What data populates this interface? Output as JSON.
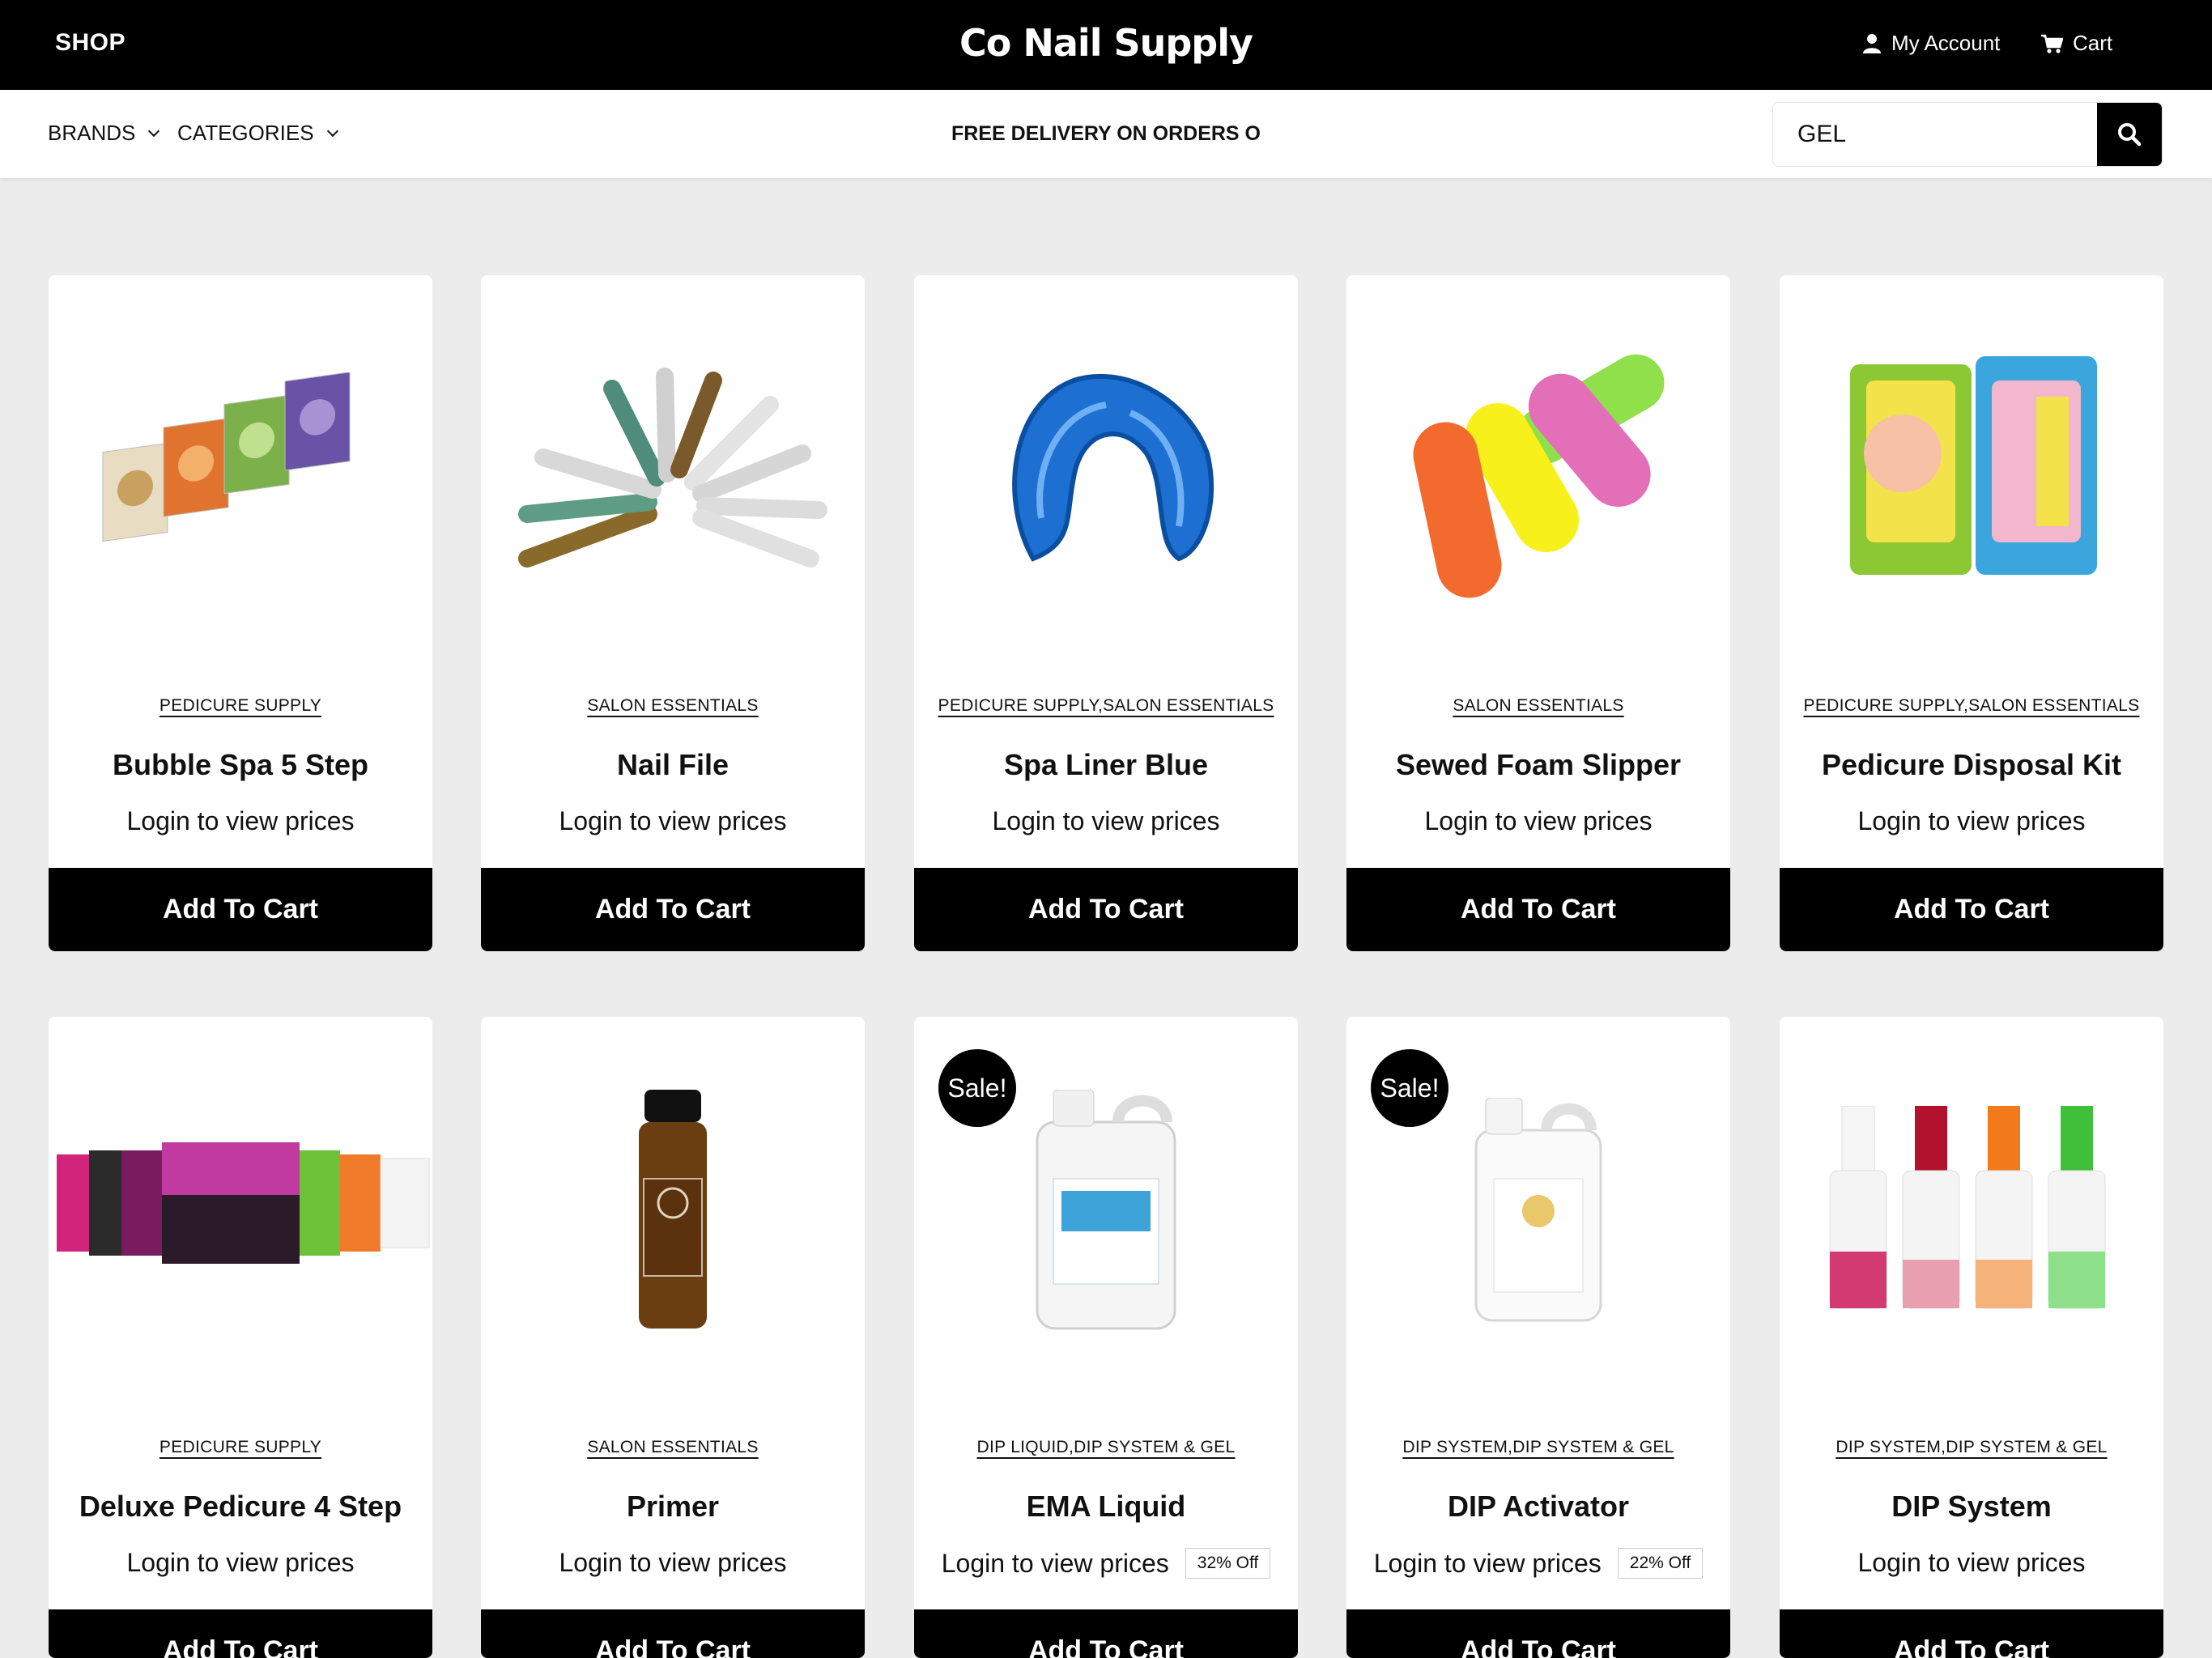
{
  "header": {
    "shop_label": "SHOP",
    "logo": "Co Nail Supply",
    "account_label": "My Account",
    "cart_label": "Cart"
  },
  "nav": {
    "brands_label": "BRANDS",
    "categories_label": "CATEGORIES",
    "promo": "FREE DELIVERY ON ORDERS O"
  },
  "search": {
    "value": "GEL"
  },
  "colors": {
    "header_bg": "#000000",
    "page_bg": "#ececec",
    "button_bg": "#000000"
  },
  "products": [
    {
      "category": "PEDICURE SUPPLY",
      "name": "Bubble Spa 5 Step",
      "price": "Login to view prices",
      "button": "Add To Cart",
      "image": "bubble-spa-packets"
    },
    {
      "category": "SALON ESSENTIALS",
      "name": "Nail File",
      "price": "Login to view prices",
      "button": "Add To Cart",
      "image": "nail-files-fan"
    },
    {
      "category": "PEDICURE SUPPLY,SALON ESSENTIALS",
      "name": "Spa Liner Blue",
      "price": "Login to view prices",
      "button": "Add To Cart",
      "image": "blue-spa-liner"
    },
    {
      "category": "SALON ESSENTIALS",
      "name": "Sewed Foam Slipper",
      "price": "Login to view prices",
      "button": "Add To Cart",
      "image": "foam-slippers"
    },
    {
      "category": "PEDICURE SUPPLY,SALON ESSENTIALS",
      "name": "Pedicure Disposal Kit",
      "price": "Login to view prices",
      "button": "Add To Cart",
      "image": "disposable-pedicure-kits"
    },
    {
      "category": "PEDICURE SUPPLY",
      "name": "Deluxe Pedicure 4 Step",
      "price": "Login to view prices",
      "button": "Add To Cart",
      "image": "deluxe-pedicure-boxes"
    },
    {
      "category": "SALON ESSENTIALS",
      "name": "Primer",
      "price": "Login to view prices",
      "button": "Add To Cart",
      "image": "primer-bottle"
    },
    {
      "category": "DIP LIQUID,DIP SYSTEM & GEL",
      "name": "EMA Liquid",
      "price": "Login to view prices",
      "button": "Add To Cart",
      "sale": "Sale!",
      "discount": "32% Off",
      "image": "ema-liquid-gallon"
    },
    {
      "category": "DIP SYSTEM,DIP SYSTEM & GEL",
      "name": "DIP Activator",
      "price": "Login to view prices",
      "button": "Add To Cart",
      "sale": "Sale!",
      "discount": "22% Off",
      "image": "dip-activator-gallon"
    },
    {
      "category": "DIP SYSTEM,DIP SYSTEM & GEL",
      "name": "DIP System",
      "price": "Login to view prices",
      "button": "Add To Cart",
      "image": "dip-system-bottles"
    }
  ]
}
